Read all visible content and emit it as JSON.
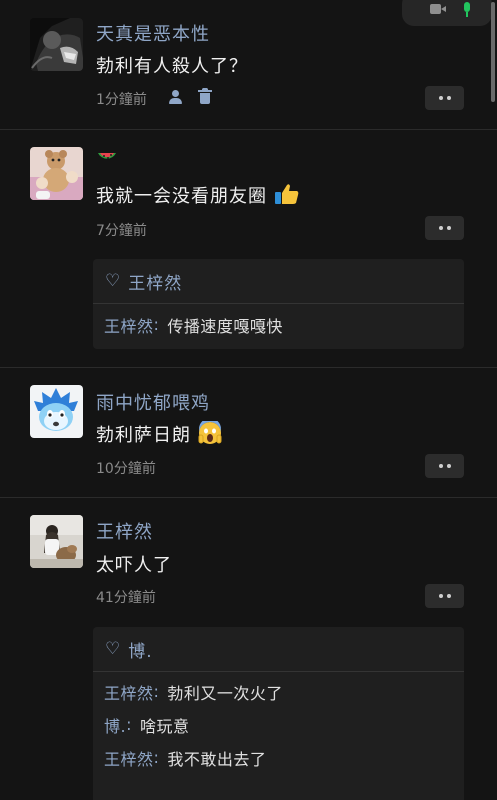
{
  "posts": [
    {
      "name": "天真是恶本性",
      "content": "勃利有人殺人了？",
      "time": "1分鐘前",
      "likes_name": "",
      "comments": []
    },
    {
      "name": "",
      "content": "我就一会没看朋友圈",
      "time": "7分鐘前",
      "likes_name": "王梓然",
      "comments": [
        {
          "author": "王梓然",
          "text": "传播速度嘎嘎快"
        }
      ]
    },
    {
      "name": "雨中忧郁喂鸡",
      "content": "勃利萨日朗",
      "time": "10分鐘前",
      "likes_name": "",
      "comments": []
    },
    {
      "name": "王梓然",
      "content": "太吓人了",
      "time": "41分鐘前",
      "likes_name": "博.",
      "comments": [
        {
          "author": "王梓然",
          "text": "勃利又一次火了"
        },
        {
          "author": "博.",
          "text": "啥玩意"
        },
        {
          "author": "王梓然",
          "text": "我不敢出去了"
        }
      ]
    }
  ],
  "icons": {
    "more": "more-dots-icon",
    "like": "heart-icon",
    "privacy": "person-icon",
    "delete": "trash-icon",
    "camera": "camera-icon",
    "mic": "mic-icon"
  },
  "colors": {
    "background": "#141414",
    "name_link": "#8fa6c7",
    "mic_active": "#22c55e"
  }
}
